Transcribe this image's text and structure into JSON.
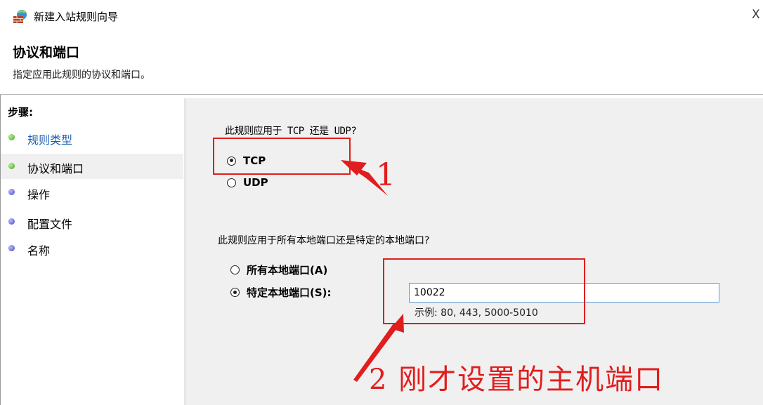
{
  "window": {
    "title": "新建入站规则向导",
    "close_glyph": "X",
    "icon": "firewall-wall-icon"
  },
  "header": {
    "title": "协议和端口",
    "subtitle": "指定应用此规则的协议和端口。"
  },
  "sidebar": {
    "heading": "步骤:",
    "items": [
      {
        "label": "规则类型",
        "dot_color": "#3fa520"
      },
      {
        "label": "协议和端口",
        "dot_color": "#3fa520"
      },
      {
        "label": "操作",
        "dot_color": "#4747c7"
      },
      {
        "label": "配置文件",
        "dot_color": "#4747c7"
      },
      {
        "label": "名称",
        "dot_color": "#4747c7"
      }
    ]
  },
  "main": {
    "protocol_question": "此规则应用于 TCP 还是 UDP?",
    "protocol_options": [
      {
        "label": "TCP",
        "checked": true
      },
      {
        "label": "UDP",
        "checked": false
      }
    ],
    "port_question": "此规则应用于所有本地端口还是特定的本地端口?",
    "port_options": [
      {
        "label": "所有本地端口(A)",
        "checked": false
      },
      {
        "label": "特定本地端口(S):",
        "checked": true
      }
    ],
    "port_value": "10022",
    "port_example": "示例: 80, 443, 5000-5010"
  },
  "annotations": {
    "label_1": "1",
    "label_2": "2 刚才设置的主机端口",
    "color": "#e11d1d"
  }
}
